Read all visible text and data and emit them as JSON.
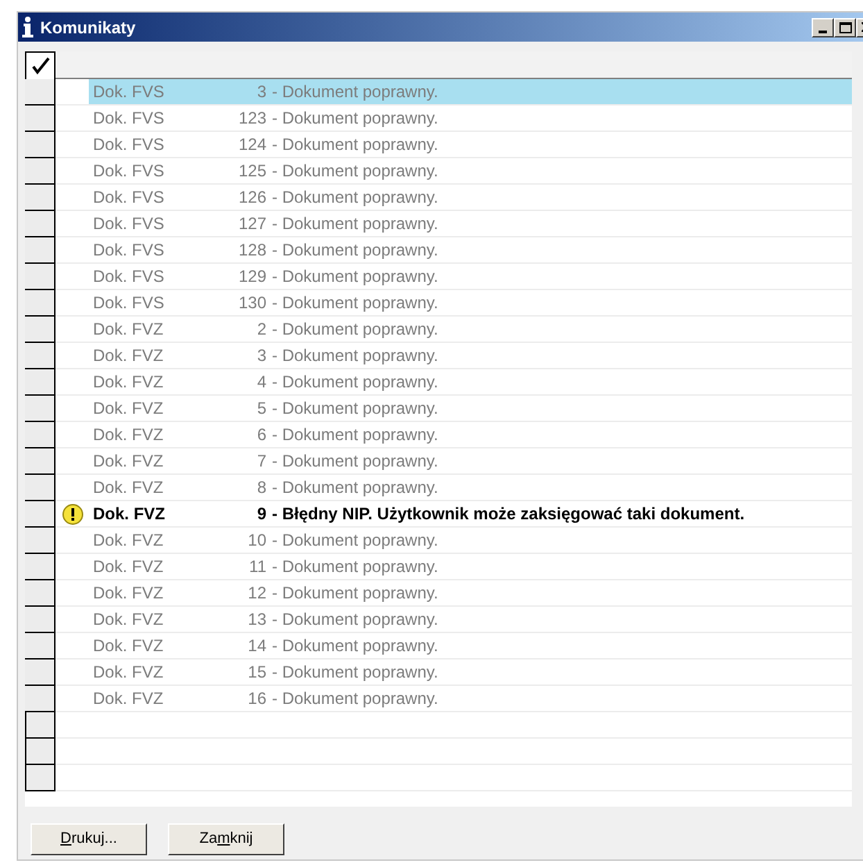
{
  "window": {
    "title": "Komunikaty"
  },
  "rows": [
    {
      "doc": "Dok. FVS",
      "number": "3",
      "message": "- Dokument poprawny.",
      "kind": "ok",
      "selected": true
    },
    {
      "doc": "Dok. FVS",
      "number": "123",
      "message": "- Dokument poprawny.",
      "kind": "ok",
      "selected": false
    },
    {
      "doc": "Dok. FVS",
      "number": "124",
      "message": "- Dokument poprawny.",
      "kind": "ok",
      "selected": false
    },
    {
      "doc": "Dok. FVS",
      "number": "125",
      "message": "- Dokument poprawny.",
      "kind": "ok",
      "selected": false
    },
    {
      "doc": "Dok. FVS",
      "number": "126",
      "message": "- Dokument poprawny.",
      "kind": "ok",
      "selected": false
    },
    {
      "doc": "Dok. FVS",
      "number": "127",
      "message": "- Dokument poprawny.",
      "kind": "ok",
      "selected": false
    },
    {
      "doc": "Dok. FVS",
      "number": "128",
      "message": "- Dokument poprawny.",
      "kind": "ok",
      "selected": false
    },
    {
      "doc": "Dok. FVS",
      "number": "129",
      "message": "- Dokument poprawny.",
      "kind": "ok",
      "selected": false
    },
    {
      "doc": "Dok. FVS",
      "number": "130",
      "message": "- Dokument poprawny.",
      "kind": "ok",
      "selected": false
    },
    {
      "doc": "Dok. FVZ",
      "number": "2",
      "message": "- Dokument poprawny.",
      "kind": "ok",
      "selected": false
    },
    {
      "doc": "Dok. FVZ",
      "number": "3",
      "message": "- Dokument poprawny.",
      "kind": "ok",
      "selected": false
    },
    {
      "doc": "Dok. FVZ",
      "number": "4",
      "message": "- Dokument poprawny.",
      "kind": "ok",
      "selected": false
    },
    {
      "doc": "Dok. FVZ",
      "number": "5",
      "message": "- Dokument poprawny.",
      "kind": "ok",
      "selected": false
    },
    {
      "doc": "Dok. FVZ",
      "number": "6",
      "message": "- Dokument poprawny.",
      "kind": "ok",
      "selected": false
    },
    {
      "doc": "Dok. FVZ",
      "number": "7",
      "message": "- Dokument poprawny.",
      "kind": "ok",
      "selected": false
    },
    {
      "doc": "Dok. FVZ",
      "number": "8",
      "message": "- Dokument poprawny.",
      "kind": "ok",
      "selected": false
    },
    {
      "doc": "Dok. FVZ",
      "number": "9",
      "message": "- Błędny NIP. Użytkownik może zaksięgować taki dokument.",
      "kind": "warning",
      "selected": false
    },
    {
      "doc": "Dok. FVZ",
      "number": "10",
      "message": "- Dokument poprawny.",
      "kind": "ok",
      "selected": false
    },
    {
      "doc": "Dok. FVZ",
      "number": "11",
      "message": "- Dokument poprawny.",
      "kind": "ok",
      "selected": false
    },
    {
      "doc": "Dok. FVZ",
      "number": "12",
      "message": "- Dokument poprawny.",
      "kind": "ok",
      "selected": false
    },
    {
      "doc": "Dok. FVZ",
      "number": "13",
      "message": "- Dokument poprawny.",
      "kind": "ok",
      "selected": false
    },
    {
      "doc": "Dok. FVZ",
      "number": "14",
      "message": "- Dokument poprawny.",
      "kind": "ok",
      "selected": false
    },
    {
      "doc": "Dok. FVZ",
      "number": "15",
      "message": "- Dokument poprawny.",
      "kind": "ok",
      "selected": false
    },
    {
      "doc": "Dok. FVZ",
      "number": "16",
      "message": "- Dokument poprawny.",
      "kind": "ok",
      "selected": false
    }
  ],
  "buttons": [
    {
      "mnemonic": "D",
      "after": "rukuj..."
    },
    {
      "before": "Za",
      "mnemonic": "m",
      "after": "knij"
    }
  ]
}
